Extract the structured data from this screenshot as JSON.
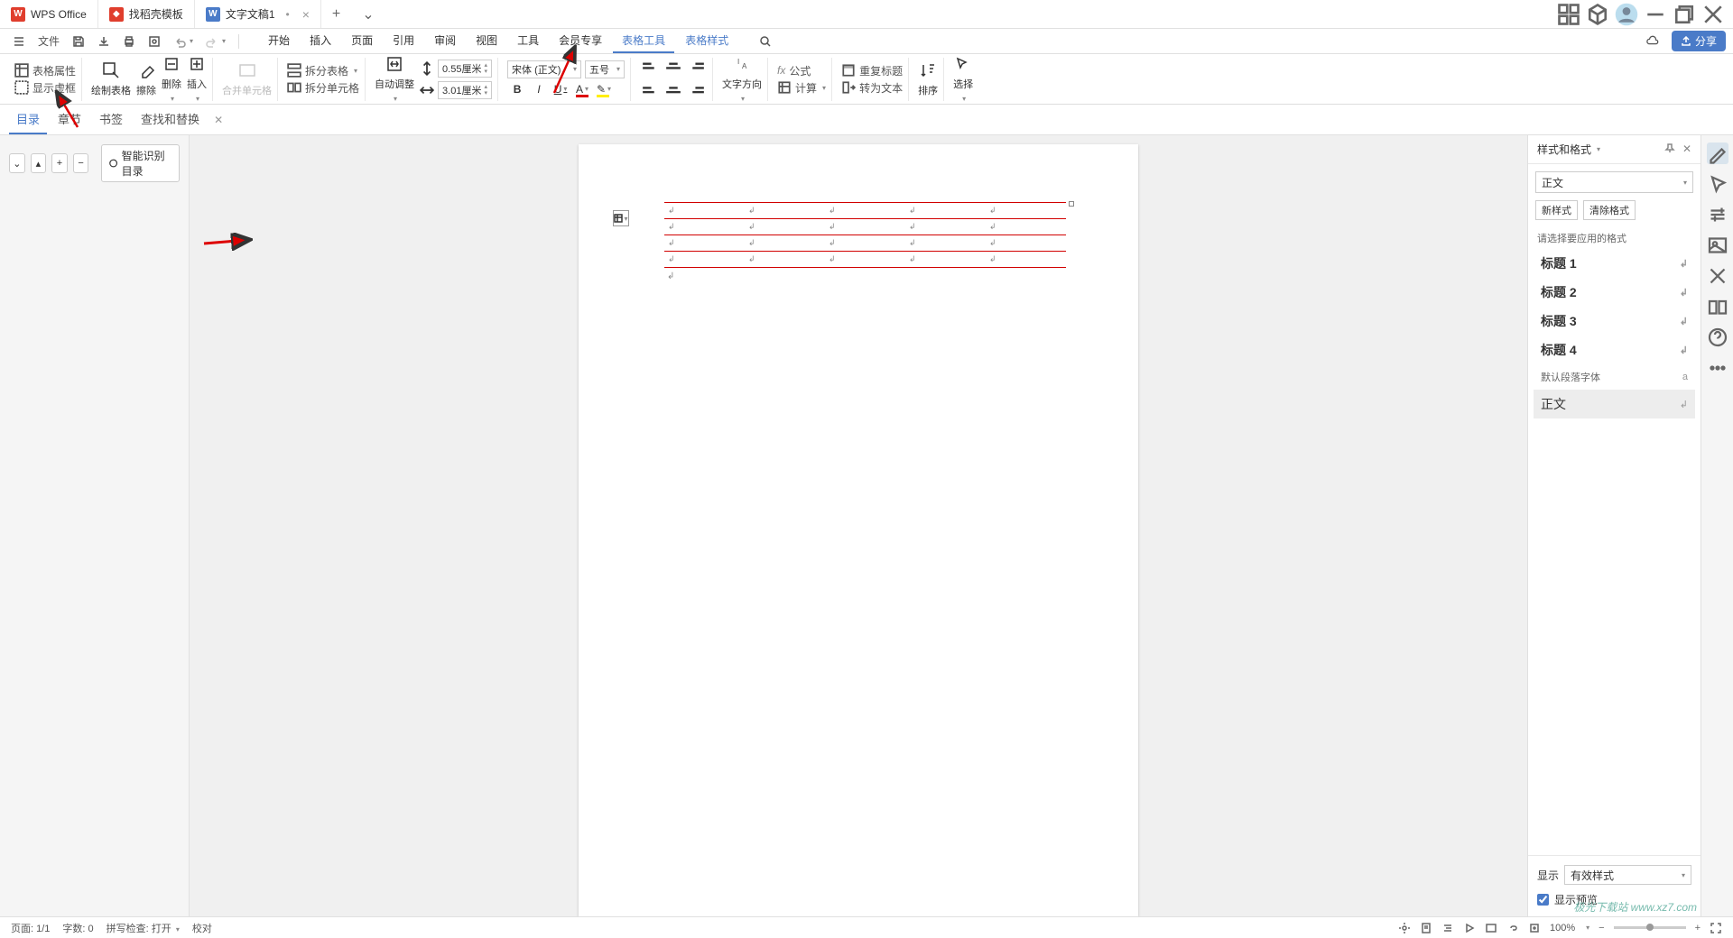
{
  "tabs": {
    "wps": "WPS Office",
    "template": "找稻壳模板",
    "doc": "文字文稿1",
    "doc_modified": "•",
    "add": "+",
    "dropdown": "⌄"
  },
  "window_controls": {
    "apps": "⊞",
    "cube": "⬡",
    "user": "👤",
    "min": "—",
    "max": "❐",
    "close": "✕"
  },
  "menubar": {
    "file": "文件",
    "tabs": [
      "开始",
      "插入",
      "页面",
      "引用",
      "审阅",
      "视图",
      "工具",
      "会员专享",
      "表格工具",
      "表格样式"
    ],
    "active_idx": 8,
    "highlight_idx": 9,
    "cloud": "☁",
    "share": "分享"
  },
  "ribbon": {
    "table_props": "表格属性",
    "show_border": "显示虚框",
    "draw_table": "绘制表格",
    "erase": "擦除",
    "delete": "删除",
    "insert": "插入",
    "merge_cells": "合并单元格",
    "split_table": "拆分表格",
    "split_cells": "拆分单元格",
    "autofit": "自动调整",
    "height": "0.55厘米",
    "width": "3.01厘米",
    "font": "宋体 (正文)",
    "size": "五号",
    "bold": "B",
    "italic": "I",
    "underline": "U",
    "text_direction": "文字方向",
    "formula": "公式",
    "calc": "计算",
    "repeat_header": "重复标题",
    "to_text": "转为文本",
    "sort": "排序",
    "select": "选择"
  },
  "nav": {
    "tabs": [
      "目录",
      "章节",
      "书签",
      "查找和替换"
    ],
    "active_idx": 0,
    "close": "✕"
  },
  "left_panel": {
    "dropdown": "⌄",
    "up": "▴",
    "plus": "+",
    "minus": "−",
    "recognize": "智能识别目录"
  },
  "doc": {
    "cell_mark": "↲",
    "para_mark": "↲"
  },
  "right_panel": {
    "title": "样式和格式",
    "pin": "⧉",
    "close": "✕",
    "current": "正文",
    "new_style": "新样式",
    "clear_format": "清除格式",
    "label": "请选择要应用的格式",
    "styles": [
      {
        "name": "标题 1",
        "indicator": "↲",
        "bold": true
      },
      {
        "name": "标题 2",
        "indicator": "↲",
        "bold": true
      },
      {
        "name": "标题 3",
        "indicator": "↲",
        "bold": true
      },
      {
        "name": "标题 4",
        "indicator": "↲",
        "bold": true
      },
      {
        "name": "默认段落字体",
        "indicator": "a",
        "small": true
      },
      {
        "name": "正文",
        "indicator": "↲",
        "selected": true
      }
    ],
    "show_label": "显示",
    "show_value": "有效样式",
    "preview": "显示预览"
  },
  "statusbar": {
    "page": "页面: 1/1",
    "words": "字数: 0",
    "spell": "拼写检查: 打开",
    "proof": "校对",
    "zoom": "100%"
  },
  "watermark": "极光下载站 www.xz7.com"
}
